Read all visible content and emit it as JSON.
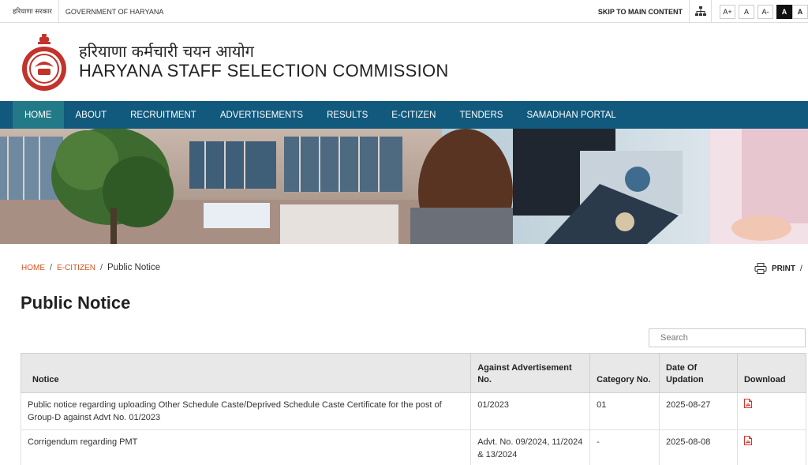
{
  "topbar": {
    "hindi_gov": "हरियाणा सरकार",
    "gov": "GOVERNMENT OF HARYANA",
    "skip": "SKIP TO MAIN CONTENT",
    "font_increase": "A+",
    "font_normal": "A",
    "font_decrease": "A-",
    "contrast_dark": "A",
    "contrast_light": "A"
  },
  "header": {
    "hindi_title": "हरियाणा कर्मचारी चयन आयोग",
    "title": "HARYANA STAFF SELECTION COMMISSION"
  },
  "nav": {
    "items": [
      "HOME",
      "ABOUT",
      "RECRUITMENT",
      "ADVERTISEMENTS",
      "RESULTS",
      "E-CITIZEN",
      "TENDERS",
      "SAMADHAN PORTAL"
    ]
  },
  "breadcrumb": {
    "home": "HOME",
    "ecitizen": "E-CITIZEN",
    "current": "Public Notice"
  },
  "print_label": "PRINT",
  "page_title": "Public Notice",
  "search": {
    "placeholder": "Search"
  },
  "table": {
    "headers": {
      "notice": "Notice",
      "advt": "Against Advertisement No.",
      "category": "Category No.",
      "date": "Date Of Updation",
      "download": "Download"
    },
    "rows": [
      {
        "notice": "Public notice regarding uploading Other Schedule Caste/Deprived Schedule Caste Certificate for the post of Group-D against Advt No. 01/2023",
        "advt": "01/2023",
        "category": "01",
        "date": "2025-08-27"
      },
      {
        "notice": "Corrigendum regarding PMT",
        "advt": "Advt. No. 09/2024, 11/2024 & 13/2024",
        "category": "-",
        "date": "2025-08-08"
      }
    ]
  },
  "colors": {
    "nav_bg": "#11597d",
    "nav_active": "#227a88",
    "link_orange": "#d8541f",
    "pdf_red": "#d9322b"
  }
}
